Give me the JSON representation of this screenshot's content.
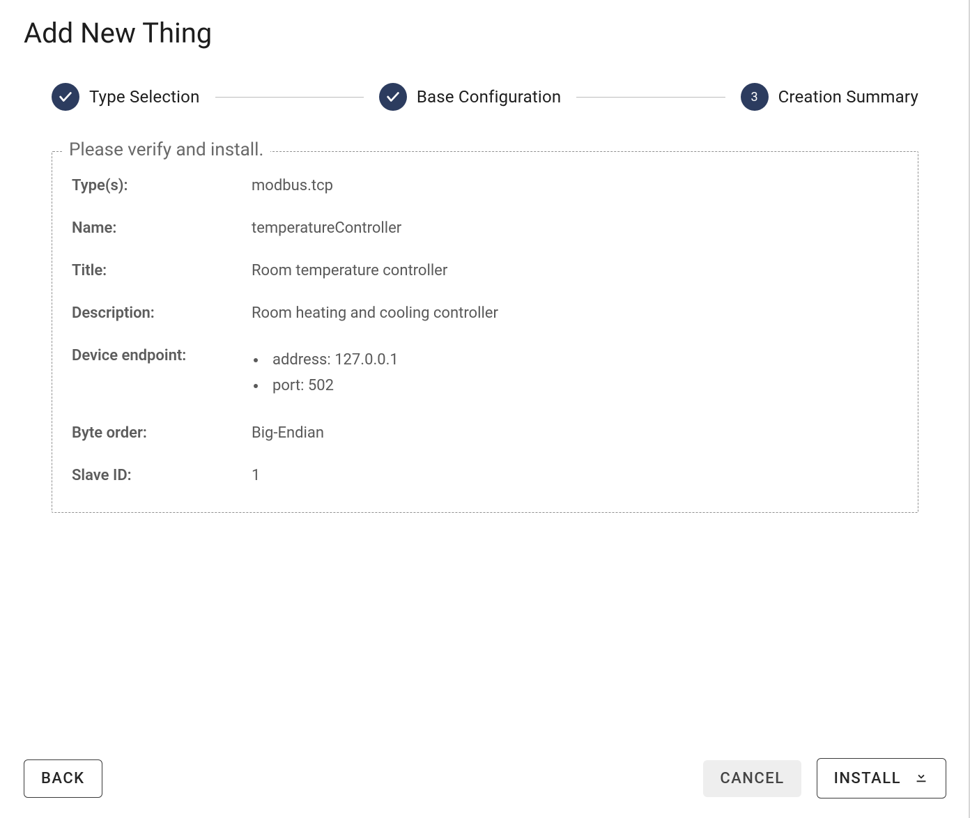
{
  "header": {
    "title": "Add New Thing"
  },
  "stepper": {
    "step1_label": "Type Selection",
    "step2_label": "Base Configuration",
    "step3_number": "3",
    "step3_label": "Creation Summary"
  },
  "panel": {
    "legend": "Please verify and install.",
    "labels": {
      "types": "Type(s):",
      "name": "Name:",
      "title": "Title:",
      "description": "Description:",
      "endpoint": "Device endpoint:",
      "byte_order": "Byte order:",
      "slave_id": "Slave ID:"
    },
    "values": {
      "types": "modbus.tcp",
      "name": "temperatureController",
      "title": "Room temperature controller",
      "description": "Room heating and cooling controller",
      "endpoint_address": "address: 127.0.0.1",
      "endpoint_port": "port: 502",
      "byte_order": "Big-Endian",
      "slave_id": "1"
    }
  },
  "footer": {
    "back": "BACK",
    "cancel": "CANCEL",
    "install": "INSTALL"
  }
}
